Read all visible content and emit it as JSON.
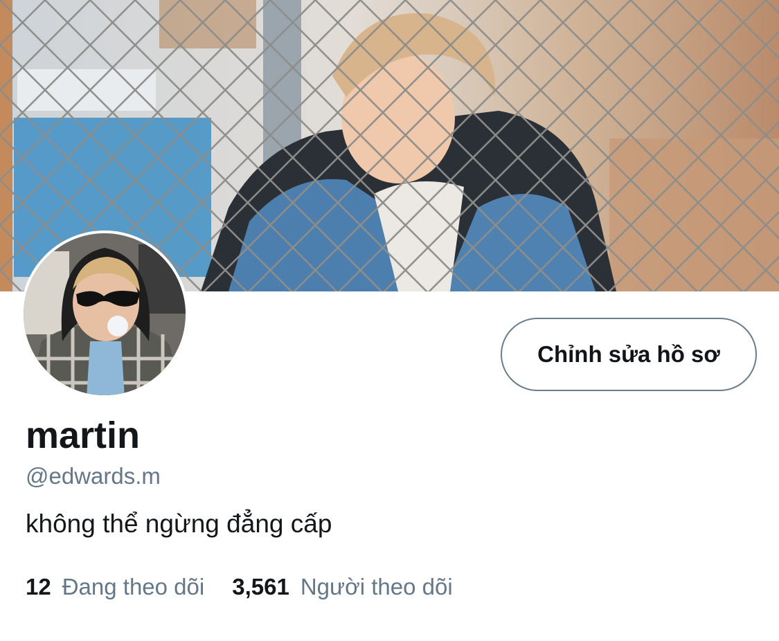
{
  "profile": {
    "banner": "banner-photo",
    "avatar": "avatar-photo",
    "edit_button_label": "Chỉnh sửa hồ sơ",
    "display_name": "martin",
    "handle": "@edwards.m",
    "bio": "không thể ngừng đẳng cấp",
    "stats": {
      "following_count": "12",
      "following_label": "Đang theo dõi",
      "followers_count": "3,561",
      "followers_label": "Người theo dõi"
    }
  },
  "colors": {
    "background": "#ffffff",
    "text_primary": "#14171a",
    "text_secondary": "#657786",
    "button_border": "#6b7c8b"
  }
}
